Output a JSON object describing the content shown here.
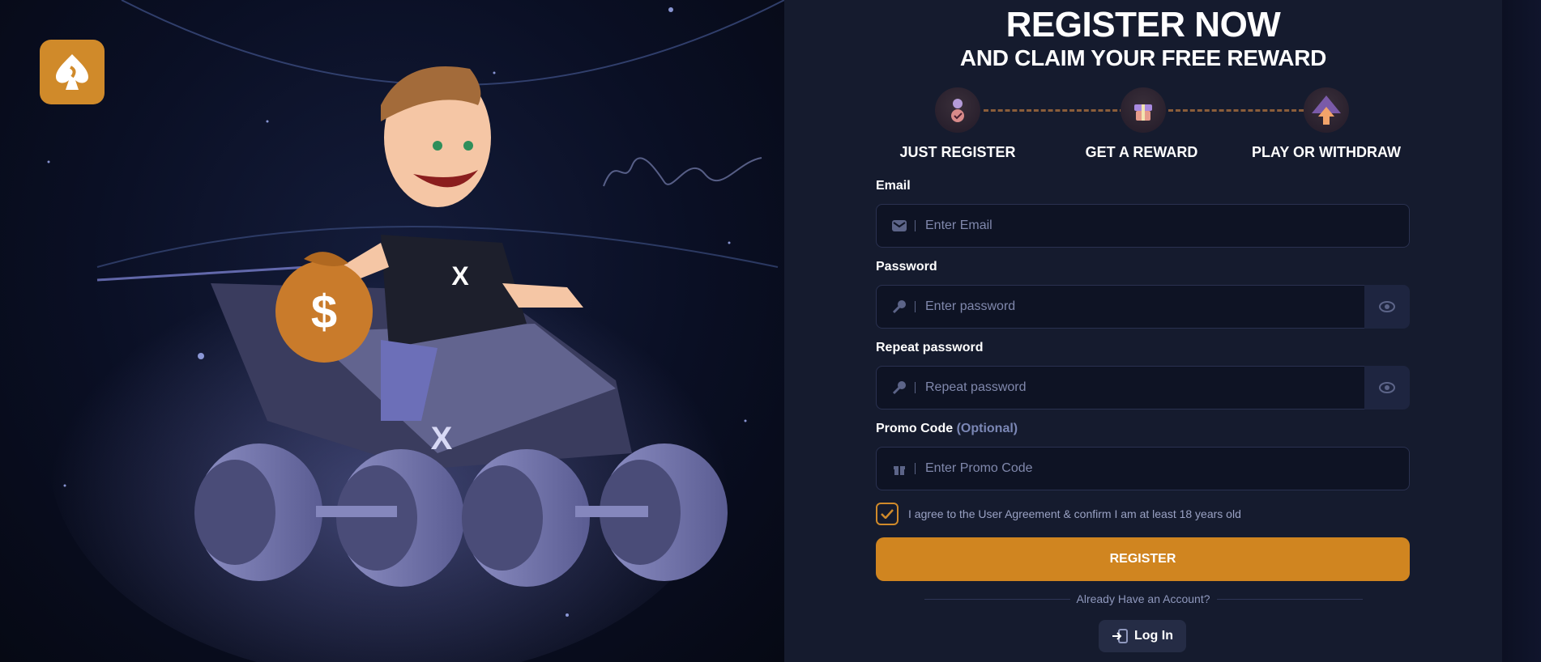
{
  "header": {
    "title": "REGISTER NOW",
    "subtitle": "AND CLAIM YOUR FREE REWARD"
  },
  "steps": [
    {
      "label": "JUST REGISTER",
      "icon": "user-check-icon"
    },
    {
      "label": "GET A REWARD",
      "icon": "gift-box-icon"
    },
    {
      "label": "PLAY OR WITHDRAW",
      "icon": "arrow-up-icon"
    }
  ],
  "form": {
    "email": {
      "label": "Email",
      "placeholder": "Enter Email",
      "icon": "mail-icon"
    },
    "password": {
      "label": "Password",
      "placeholder": "Enter password",
      "icon": "key-icon"
    },
    "repeat_password": {
      "label": "Repeat password",
      "placeholder": "Repeat password",
      "icon": "key-icon"
    },
    "promo": {
      "label": "Promo Code",
      "optional": "(Optional)",
      "placeholder": "Enter Promo Code",
      "icon": "gift-icon"
    },
    "agreement": {
      "text": "I agree to the User Agreement & confirm I am at least 18 years old",
      "checked": true
    },
    "register_label": "REGISTER"
  },
  "footer": {
    "already_text": "Already Have an Account?",
    "login_label": "Log In"
  },
  "colors": {
    "accent": "#d08520",
    "panel_bg": "#151b2e",
    "input_bg": "#0e1324"
  }
}
